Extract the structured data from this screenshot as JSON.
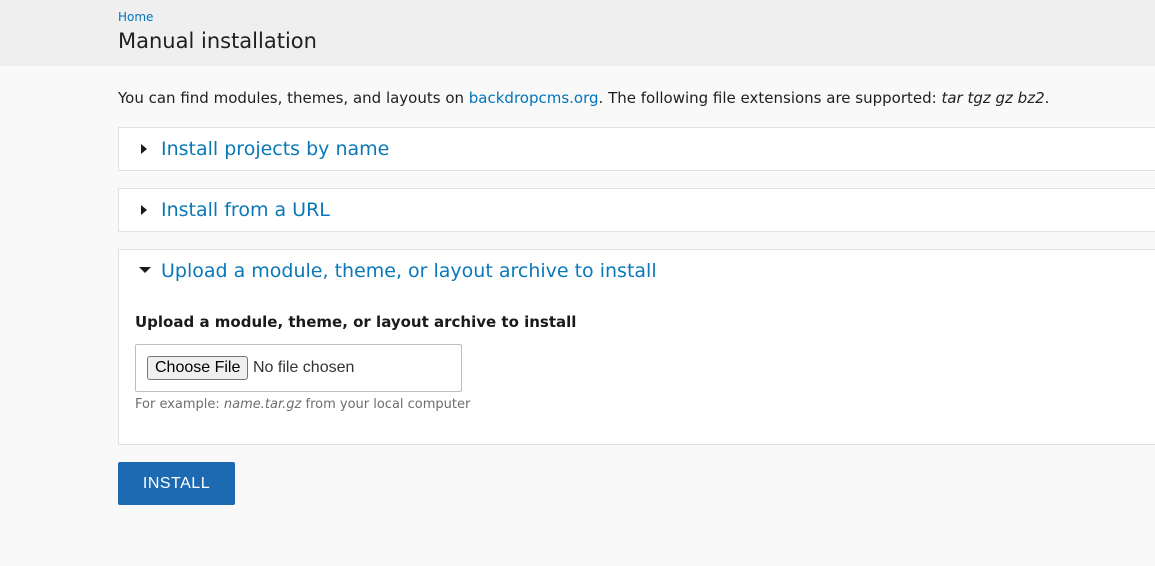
{
  "breadcrumb": {
    "home": "Home"
  },
  "page_title": "Manual installation",
  "intro": {
    "prefix": "You can find modules, themes, and layouts on ",
    "link": "backdropcms.org",
    "middle": ". The following file extensions are supported: ",
    "extensions": "tar tgz gz bz2",
    "suffix": "."
  },
  "sections": [
    {
      "title": "Install projects by name",
      "expanded": false
    },
    {
      "title": "Install from a URL",
      "expanded": false
    },
    {
      "title": "Upload a module, theme, or layout archive to install",
      "expanded": true
    }
  ],
  "upload": {
    "label": "Upload a module, theme, or layout archive to install",
    "choose_button": "Choose File",
    "no_file": "No file chosen",
    "help_prefix": "For example: ",
    "help_example": "name.tar.gz",
    "help_suffix": " from your local computer"
  },
  "install_button": "INSTALL",
  "colors": {
    "link": "#0074bd",
    "primary_button": "#1d69b2",
    "header_bg": "#efefef"
  },
  "icons": {
    "collapsed": "triangle-right-icon",
    "expanded": "triangle-down-icon"
  }
}
